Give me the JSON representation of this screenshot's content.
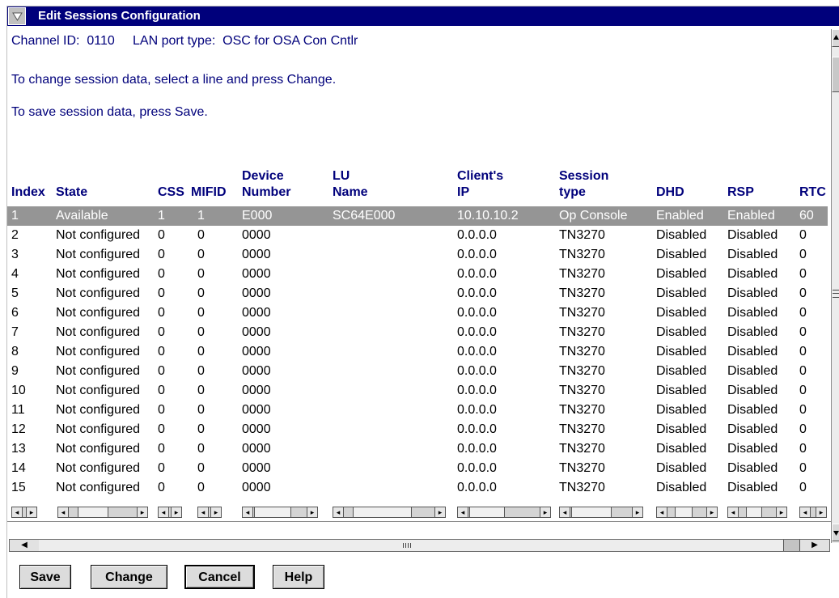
{
  "window": {
    "title": "Edit Sessions Configuration"
  },
  "info": {
    "channel_line": "Channel ID:  0110     LAN port type:  OSC for OSA Con Cntlr",
    "change_hint": "To change session data, select a line and press Change.",
    "save_hint": "To save session data, press Save."
  },
  "table": {
    "headers": {
      "index": "Index",
      "state": "State",
      "css": "CSS",
      "mifid": "MIFID",
      "device": "Device\nNumber",
      "lu": "LU\nName",
      "client": "Client's\nIP",
      "session": "Session\ntype",
      "dhd": "DHD",
      "rsp": "RSP",
      "rtc": "RTC"
    },
    "rows": [
      {
        "index": "1",
        "state": "Available",
        "css": "1",
        "mifid": "1",
        "device": "E000",
        "lu": "SC64E000",
        "client": "10.10.10.2",
        "session": "Op Console",
        "dhd": "Enabled",
        "rsp": "Enabled",
        "rtc": "60",
        "selected": true
      },
      {
        "index": "2",
        "state": "Not configured",
        "css": "0",
        "mifid": "0",
        "device": "0000",
        "lu": "",
        "client": "0.0.0.0",
        "session": "TN3270",
        "dhd": "Disabled",
        "rsp": "Disabled",
        "rtc": "0"
      },
      {
        "index": "3",
        "state": "Not configured",
        "css": "0",
        "mifid": "0",
        "device": "0000",
        "lu": "",
        "client": "0.0.0.0",
        "session": "TN3270",
        "dhd": "Disabled",
        "rsp": "Disabled",
        "rtc": "0"
      },
      {
        "index": "4",
        "state": "Not configured",
        "css": "0",
        "mifid": "0",
        "device": "0000",
        "lu": "",
        "client": "0.0.0.0",
        "session": "TN3270",
        "dhd": "Disabled",
        "rsp": "Disabled",
        "rtc": "0"
      },
      {
        "index": "5",
        "state": "Not configured",
        "css": "0",
        "mifid": "0",
        "device": "0000",
        "lu": "",
        "client": "0.0.0.0",
        "session": "TN3270",
        "dhd": "Disabled",
        "rsp": "Disabled",
        "rtc": "0"
      },
      {
        "index": "6",
        "state": "Not configured",
        "css": "0",
        "mifid": "0",
        "device": "0000",
        "lu": "",
        "client": "0.0.0.0",
        "session": "TN3270",
        "dhd": "Disabled",
        "rsp": "Disabled",
        "rtc": "0"
      },
      {
        "index": "7",
        "state": "Not configured",
        "css": "0",
        "mifid": "0",
        "device": "0000",
        "lu": "",
        "client": "0.0.0.0",
        "session": "TN3270",
        "dhd": "Disabled",
        "rsp": "Disabled",
        "rtc": "0"
      },
      {
        "index": "8",
        "state": "Not configured",
        "css": "0",
        "mifid": "0",
        "device": "0000",
        "lu": "",
        "client": "0.0.0.0",
        "session": "TN3270",
        "dhd": "Disabled",
        "rsp": "Disabled",
        "rtc": "0"
      },
      {
        "index": "9",
        "state": "Not configured",
        "css": "0",
        "mifid": "0",
        "device": "0000",
        "lu": "",
        "client": "0.0.0.0",
        "session": "TN3270",
        "dhd": "Disabled",
        "rsp": "Disabled",
        "rtc": "0"
      },
      {
        "index": "10",
        "state": "Not configured",
        "css": "0",
        "mifid": "0",
        "device": "0000",
        "lu": "",
        "client": "0.0.0.0",
        "session": "TN3270",
        "dhd": "Disabled",
        "rsp": "Disabled",
        "rtc": "0"
      },
      {
        "index": "11",
        "state": "Not configured",
        "css": "0",
        "mifid": "0",
        "device": "0000",
        "lu": "",
        "client": "0.0.0.0",
        "session": "TN3270",
        "dhd": "Disabled",
        "rsp": "Disabled",
        "rtc": "0"
      },
      {
        "index": "12",
        "state": "Not configured",
        "css": "0",
        "mifid": "0",
        "device": "0000",
        "lu": "",
        "client": "0.0.0.0",
        "session": "TN3270",
        "dhd": "Disabled",
        "rsp": "Disabled",
        "rtc": "0"
      },
      {
        "index": "13",
        "state": "Not configured",
        "css": "0",
        "mifid": "0",
        "device": "0000",
        "lu": "",
        "client": "0.0.0.0",
        "session": "TN3270",
        "dhd": "Disabled",
        "rsp": "Disabled",
        "rtc": "0"
      },
      {
        "index": "14",
        "state": "Not configured",
        "css": "0",
        "mifid": "0",
        "device": "0000",
        "lu": "",
        "client": "0.0.0.0",
        "session": "TN3270",
        "dhd": "Disabled",
        "rsp": "Disabled",
        "rtc": "0"
      },
      {
        "index": "15",
        "state": "Not configured",
        "css": "0",
        "mifid": "0",
        "device": "0000",
        "lu": "",
        "client": "0.0.0.0",
        "session": "TN3270",
        "dhd": "Disabled",
        "rsp": "Disabled",
        "rtc": "0"
      }
    ]
  },
  "buttons": {
    "save": "Save",
    "change": "Change",
    "cancel": "Cancel",
    "help": "Help"
  },
  "colors": {
    "title_bar": "#00007b",
    "info_text": "#00007b",
    "selected_row": "#959595"
  },
  "icons": {
    "system_menu": "system-menu-icon",
    "arrows": [
      "arrow-left-icon",
      "arrow-right-icon",
      "arrow-up-icon",
      "arrow-down-icon"
    ]
  }
}
